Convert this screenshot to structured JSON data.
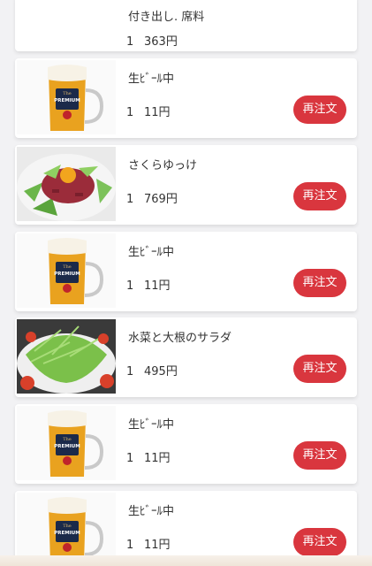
{
  "reorder_label": "再注文",
  "items": [
    {
      "name": "付き出し. 席料",
      "qty": "1",
      "price": "363円",
      "image": "none"
    },
    {
      "name": "生ﾋﾞｰﾙ中",
      "qty": "1",
      "price": "11円",
      "image": "beer-glass",
      "brand_text": "PREMIUM",
      "brand_top": "The"
    },
    {
      "name": "さくらゆっけ",
      "qty": "1",
      "price": "769円",
      "image": "yukke-plate"
    },
    {
      "name": "生ﾋﾞｰﾙ中",
      "qty": "1",
      "price": "11円",
      "image": "beer-glass",
      "brand_text": "PREMIUM",
      "brand_top": "The"
    },
    {
      "name": "水菜と大根のサラダ",
      "qty": "1",
      "price": "495円",
      "image": "salad-plate"
    },
    {
      "name": "生ﾋﾞｰﾙ中",
      "qty": "1",
      "price": "11円",
      "image": "beer-glass",
      "brand_text": "PREMIUM",
      "brand_top": "The"
    },
    {
      "name": "生ﾋﾞｰﾙ中",
      "qty": "1",
      "price": "11円",
      "image": "beer-glass",
      "brand_text": "PREMIUM",
      "brand_top": "The"
    }
  ],
  "colors": {
    "accent": "#d9363e",
    "card": "#ffffff",
    "background": "#f2f2f4"
  }
}
